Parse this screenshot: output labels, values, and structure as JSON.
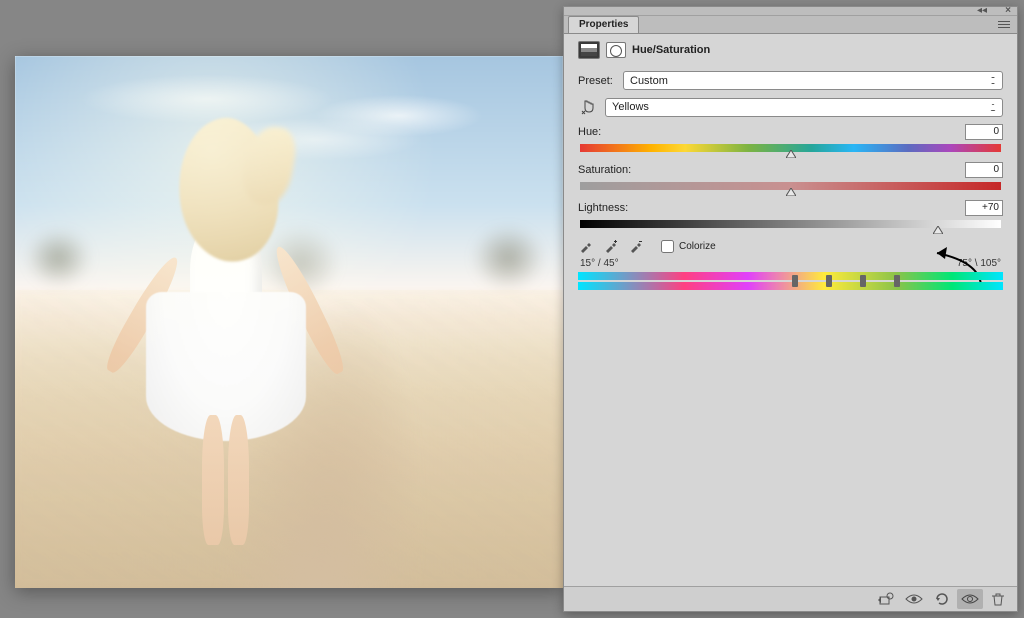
{
  "panel": {
    "tab": "Properties",
    "adjustment_title": "Hue/Saturation",
    "preset_label": "Preset:",
    "preset_value": "Custom",
    "channel_value": "Yellows",
    "sliders": {
      "hue": {
        "label": "Hue:",
        "value": "0",
        "pos": 50
      },
      "saturation": {
        "label": "Saturation:",
        "value": "0",
        "pos": 50
      },
      "lightness": {
        "label": "Lightness:",
        "value": "+70",
        "pos": 85
      }
    },
    "colorize_label": "Colorize",
    "colorize_checked": false,
    "range_left": "15° / 45°",
    "range_right": "75° \\ 105°",
    "icons": {
      "adjustment": "hue-sat-icon",
      "mask": "layer-mask-icon",
      "finger": "targeted-adjust-icon",
      "eyedropper": "eyedropper-icon",
      "eyedropper_plus": "eyedropper-plus-icon",
      "eyedropper_minus": "eyedropper-minus-icon"
    },
    "footer_icons": [
      "clip-to-layer-icon",
      "toggle-visibility-icon",
      "reset-icon",
      "view-previous-icon",
      "delete-icon"
    ]
  }
}
